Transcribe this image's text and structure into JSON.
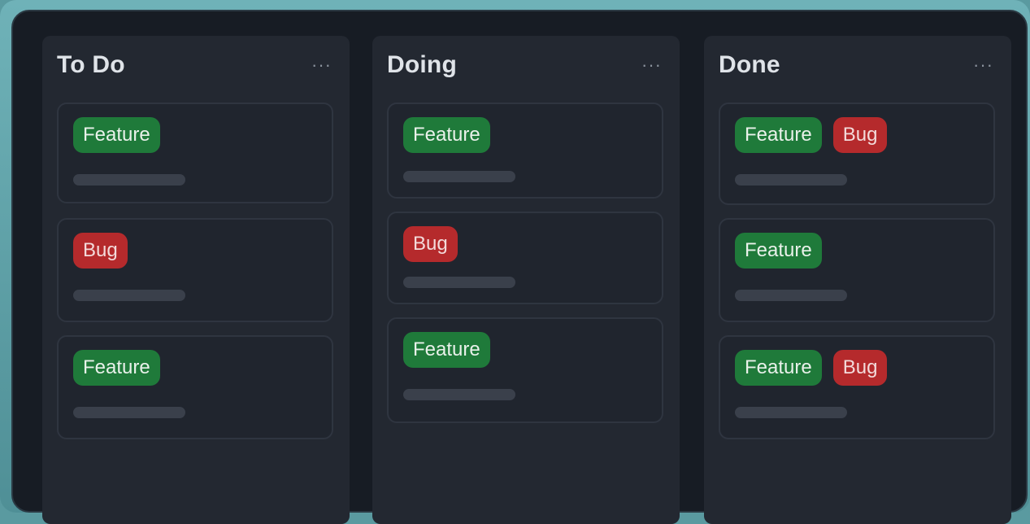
{
  "colors": {
    "frame": "#5a9aa0",
    "board": "#171c24",
    "column": "#232831",
    "card": "#20252e",
    "feature_tag": "#1f7a3a",
    "bug_tag": "#b52a2c"
  },
  "board": {
    "columns": [
      {
        "title": "To Do",
        "menu": "···",
        "cards": [
          {
            "tags": [
              "Feature"
            ]
          },
          {
            "tags": [
              "Bug"
            ]
          },
          {
            "tags": [
              "Feature"
            ]
          }
        ]
      },
      {
        "title": "Doing",
        "menu": "···",
        "cards": [
          {
            "tags": [
              "Feature"
            ]
          },
          {
            "tags": [
              "Bug"
            ]
          },
          {
            "tags": [
              "Feature"
            ]
          }
        ]
      },
      {
        "title": "Done",
        "menu": "···",
        "cards": [
          {
            "tags": [
              "Feature",
              "Bug"
            ]
          },
          {
            "tags": [
              "Feature"
            ]
          },
          {
            "tags": [
              "Feature",
              "Bug"
            ]
          }
        ]
      }
    ]
  }
}
